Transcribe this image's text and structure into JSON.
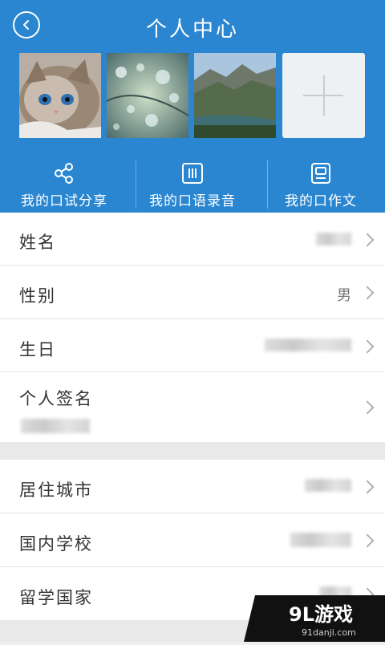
{
  "header": {
    "title": "个人中心",
    "back_icon": "chevron-left-icon"
  },
  "photos": [
    {
      "alt": "kitten-photo"
    },
    {
      "alt": "water-drops-photo"
    },
    {
      "alt": "mountain-river-photo"
    }
  ],
  "tabs": [
    {
      "label": "我的口试分享",
      "icon": "share-icon"
    },
    {
      "label": "我的口语录音",
      "icon": "audio-bars-icon"
    },
    {
      "label": "我的口作文",
      "icon": "essay-card-icon"
    }
  ],
  "profile": {
    "name_label": "姓名",
    "gender_label": "性别",
    "gender_value": "男",
    "birthday_label": "生日",
    "signature_label": "个人签名"
  },
  "location": {
    "city_label": "居住城市",
    "school_label": "国内学校",
    "country_label": "留学国家"
  },
  "watermark": {
    "brand": "9L游戏",
    "site": "91danji.com"
  },
  "colors": {
    "primary": "#2a86d0"
  }
}
